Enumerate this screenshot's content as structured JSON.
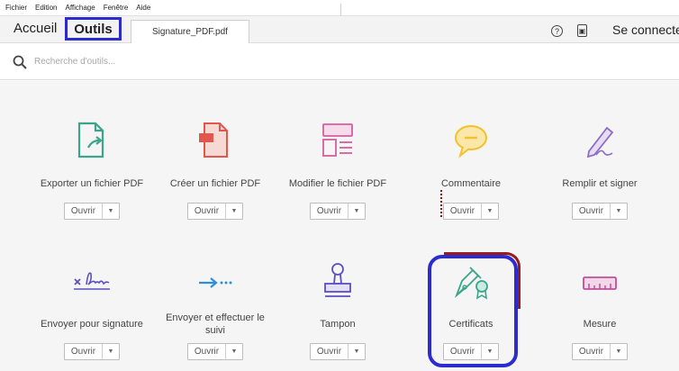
{
  "menu": [
    "Fichier",
    "Edition",
    "Affichage",
    "Fenêtre",
    "Aide"
  ],
  "tabs": {
    "home": "Accueil",
    "tools": "Outils",
    "document": "Signature_PDF.pdf"
  },
  "header": {
    "help_icon": "?",
    "mobile_icon": "▣",
    "signin": "Se connecter"
  },
  "search": {
    "placeholder": "Recherche d'outils..."
  },
  "open_label": "Ouvrir",
  "caret": "▼",
  "tools": [
    {
      "label": "Exporter un fichier PDF",
      "icon": "export-pdf-icon",
      "color": "#3aa58a"
    },
    {
      "label": "Créer un fichier PDF",
      "icon": "create-pdf-icon",
      "color": "#e0584d"
    },
    {
      "label": "Modifier le fichier PDF",
      "icon": "edit-pdf-icon",
      "color": "#d45fa0"
    },
    {
      "label": "Commentaire",
      "icon": "comment-icon",
      "color": "#f2c12e"
    },
    {
      "label": "Remplir et signer",
      "icon": "fill-sign-icon",
      "color": "#8d6cc2"
    },
    {
      "label": "Envoyer pour signature",
      "icon": "send-signature-icon",
      "color": "#5b4fc0"
    },
    {
      "label": "Envoyer et effectuer le suivi",
      "icon": "send-track-icon",
      "color": "#2f8fd6"
    },
    {
      "label": "Tampon",
      "icon": "stamp-icon",
      "color": "#5b4fc0"
    },
    {
      "label": "Certificats",
      "icon": "certificates-icon",
      "color": "#3aa58a"
    },
    {
      "label": "Mesure",
      "icon": "measure-icon",
      "color": "#c04f9a"
    }
  ],
  "colors": {
    "highlight_blue": "#2b2bcf",
    "highlight_red": "#9a1b1b"
  }
}
